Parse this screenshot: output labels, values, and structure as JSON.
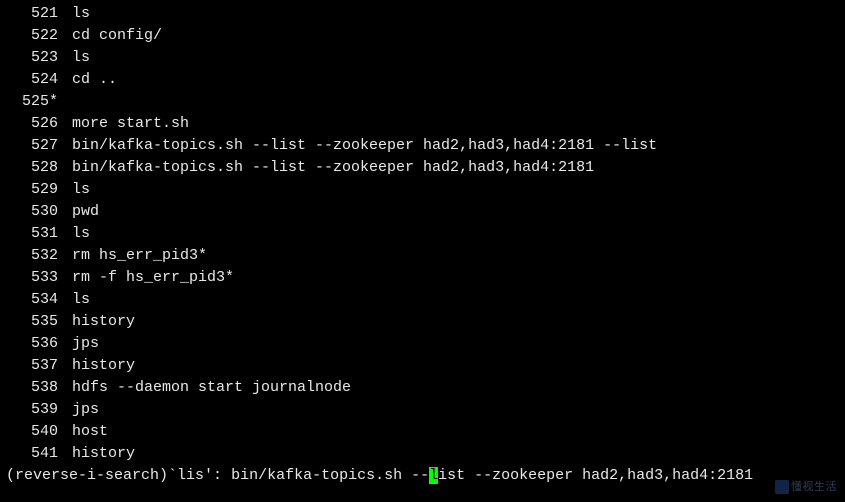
{
  "history": [
    {
      "num": "521",
      "cmd": "ls"
    },
    {
      "num": "522",
      "cmd": "cd config/"
    },
    {
      "num": "523",
      "cmd": "ls"
    },
    {
      "num": "524",
      "cmd": "cd .."
    },
    {
      "num": "525*",
      "cmd": ""
    },
    {
      "num": "526",
      "cmd": "more start.sh"
    },
    {
      "num": "527",
      "cmd": "bin/kafka-topics.sh --list --zookeeper had2,had3,had4:2181 --list"
    },
    {
      "num": "528",
      "cmd": "bin/kafka-topics.sh --list --zookeeper had2,had3,had4:2181"
    },
    {
      "num": "529",
      "cmd": "ls"
    },
    {
      "num": "530",
      "cmd": "pwd"
    },
    {
      "num": "531",
      "cmd": "ls"
    },
    {
      "num": "532",
      "cmd": "rm hs_err_pid3*"
    },
    {
      "num": "533",
      "cmd": "rm -f hs_err_pid3*"
    },
    {
      "num": "534",
      "cmd": "ls"
    },
    {
      "num": "535",
      "cmd": "history"
    },
    {
      "num": "536",
      "cmd": "jps"
    },
    {
      "num": "537",
      "cmd": "history"
    },
    {
      "num": "538",
      "cmd": "hdfs --daemon start journalnode"
    },
    {
      "num": "539",
      "cmd": "jps"
    },
    {
      "num": "540",
      "cmd": "host"
    },
    {
      "num": "541",
      "cmd": "history"
    }
  ],
  "search": {
    "prefix": "(reverse-i-search)`",
    "query": "lis",
    "sep": "': ",
    "match_before": "bin/kafka-topics.sh --",
    "cursor_char": "l",
    "match_after": "ist --zookeeper had2,had3,had4:2181"
  },
  "watermark": {
    "text": "懂视生活"
  }
}
